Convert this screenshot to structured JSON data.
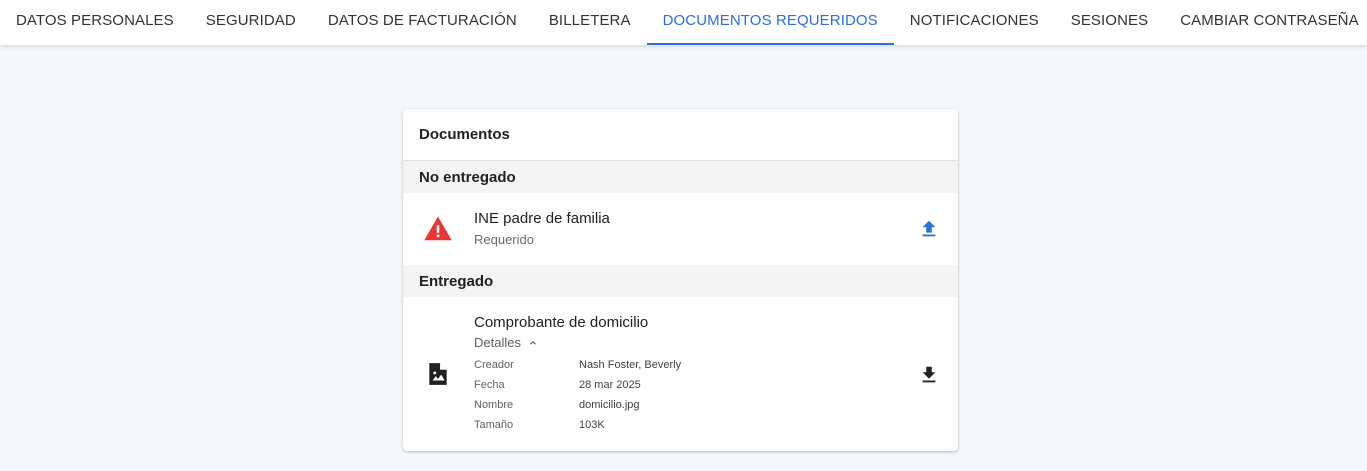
{
  "tabs": [
    {
      "label": "DATOS PERSONALES"
    },
    {
      "label": "SEGURIDAD"
    },
    {
      "label": "DATOS DE FACTURACIÓN"
    },
    {
      "label": "BILLETERA"
    },
    {
      "label": "DOCUMENTOS REQUERIDOS",
      "active": true
    },
    {
      "label": "NOTIFICACIONES"
    },
    {
      "label": "SESIONES"
    },
    {
      "label": "CAMBIAR CONTRASEÑA"
    }
  ],
  "card": {
    "title": "Documentos",
    "pending": {
      "heading": "No entregado",
      "item": {
        "title": "INE padre de familia",
        "status": "Requerido",
        "icon": "warning-icon",
        "action_icon": "upload-icon"
      }
    },
    "delivered": {
      "heading": "Entregado",
      "item": {
        "title": "Comprobante de domicilio",
        "details_label": "Detalles",
        "icon": "image-file-icon",
        "action_icon": "download-icon",
        "details": [
          {
            "key": "Creador",
            "value": "Nash Foster, Beverly"
          },
          {
            "key": "Fecha",
            "value": "28 mar 2025"
          },
          {
            "key": "Nombre",
            "value": "domicilio.jpg"
          },
          {
            "key": "Tamaño",
            "value": "103K"
          }
        ]
      }
    }
  },
  "colors": {
    "accent": "#2f6fd6",
    "warning": "#e53935",
    "upload_icon": "#2f6fd6",
    "background": "#f4f8fc"
  }
}
